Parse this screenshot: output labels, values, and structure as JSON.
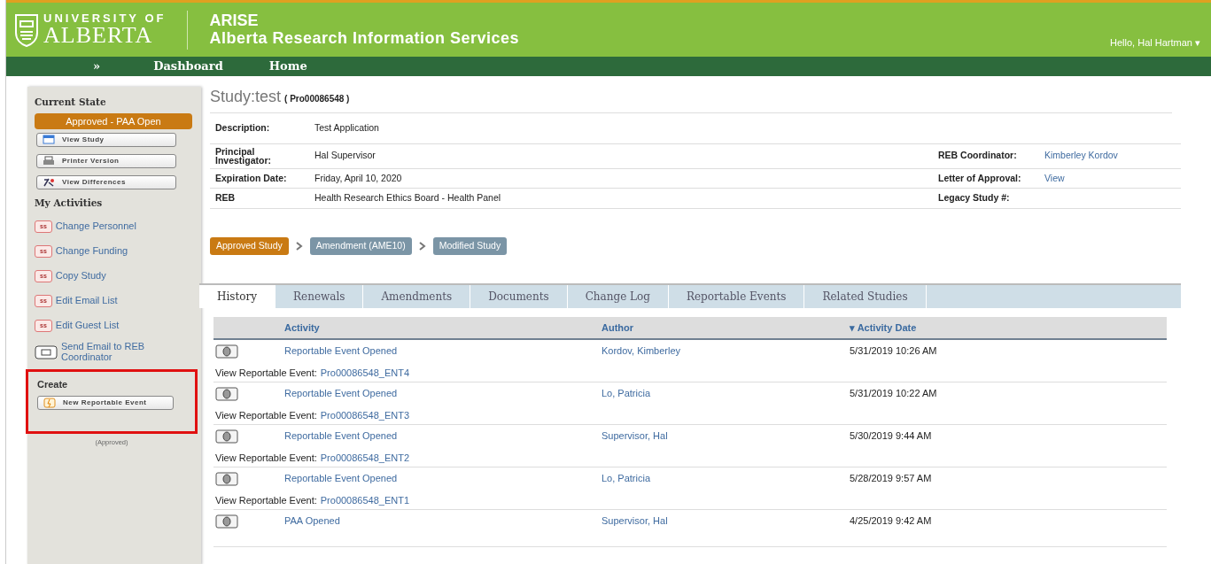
{
  "header": {
    "university_top": "UNIVERSITY OF",
    "university_name": "ALBERTA",
    "app_name": "ARISE",
    "app_full_name": "Alberta Research Information Services",
    "user_menu": "Hello, Hal Hartman ▾"
  },
  "nav": [
    {
      "label": "»",
      "kind": "toggle"
    },
    {
      "label": "Dashboard",
      "kind": "link"
    },
    {
      "label": "Home",
      "kind": "link"
    }
  ],
  "sidebar": {
    "current_state_title": "Current State",
    "state": "Approved - PAA Open",
    "buttons": [
      {
        "label": "View Study",
        "kind": "window"
      },
      {
        "label": "Printer Version",
        "kind": "printer"
      },
      {
        "label": "View Differences",
        "kind": "differences"
      }
    ],
    "activities_title": "My Activities",
    "activities": [
      {
        "label": "Change Personnel",
        "badge": "ss",
        "kind": "badge"
      },
      {
        "label": "Change Funding",
        "badge": "ss",
        "kind": "badge"
      },
      {
        "label": "Copy Study",
        "badge": "ss",
        "kind": "badge"
      },
      {
        "label": "Edit Email List",
        "badge": "ss",
        "kind": "badge"
      },
      {
        "label": "Edit Guest List",
        "badge": "ss",
        "kind": "badge"
      },
      {
        "label": "Send Email to REB Coordinator",
        "kind": "mail"
      }
    ],
    "create": {
      "title": "Create",
      "highlighted": true,
      "buttons": [
        {
          "label": "New Reportable Event",
          "kind": "event"
        }
      ],
      "note": "(Approved)"
    }
  },
  "study": {
    "title": "Study:test",
    "id": "( Pro00086548 )",
    "fields": [
      {
        "label": "Description:",
        "value": "Test Application"
      },
      {
        "label": "Principal Investigator:",
        "value": "Hal Supervisor",
        "side_label": "REB Coordinator:",
        "side_value": "Kimberley Kordov"
      },
      {
        "label": "Expiration Date:",
        "value": "Friday, April 10, 2020",
        "side_label": "Letter of Approval:",
        "side_value": "View"
      },
      {
        "label": "REB",
        "value": "Health Research Ethics Board - Health Panel",
        "side_label": "Legacy Study #:"
      }
    ],
    "workflow": [
      {
        "label": "Approved Study",
        "selected": true
      },
      {
        "label": "Amendment (AME10)",
        "selected": false
      },
      {
        "label": "Modified Study",
        "selected": false
      }
    ]
  },
  "tabs": [
    {
      "label": "History",
      "selected": true
    },
    {
      "label": "Renewals",
      "selected": false
    },
    {
      "label": "Amendments",
      "selected": false
    },
    {
      "label": "Documents",
      "selected": false
    },
    {
      "label": "Change Log",
      "selected": false
    },
    {
      "label": "Reportable Events",
      "selected": false
    },
    {
      "label": "Related Studies",
      "selected": false
    }
  ],
  "history": {
    "columns": [
      "Activity",
      "Author",
      "▾ Activity Date"
    ],
    "rows": [
      {
        "activity": "Reportable Event Opened",
        "author": "Kordov, Kimberley",
        "date": "5/31/2019 10:26 AM",
        "detail_label": "View Reportable Event:",
        "detail_link": "Pro00086548_ENT4"
      },
      {
        "activity": "Reportable Event Opened",
        "author": "Lo, Patricia",
        "date": "5/31/2019 10:22 AM",
        "detail_label": "View Reportable Event:",
        "detail_link": "Pro00086548_ENT3"
      },
      {
        "activity": "Reportable Event Opened",
        "author": "Supervisor, Hal",
        "date": "5/30/2019 9:44 AM",
        "detail_label": "View Reportable Event:",
        "detail_link": "Pro00086548_ENT2"
      },
      {
        "activity": "Reportable Event Opened",
        "author": "Lo, Patricia",
        "date": "5/28/2019 9:57 AM",
        "detail_label": "View Reportable Event:",
        "detail_link": "Pro00086548_ENT1"
      },
      {
        "activity": "PAA Opened",
        "author": "Supervisor, Hal",
        "date": "4/25/2019 9:42 AM"
      }
    ]
  }
}
